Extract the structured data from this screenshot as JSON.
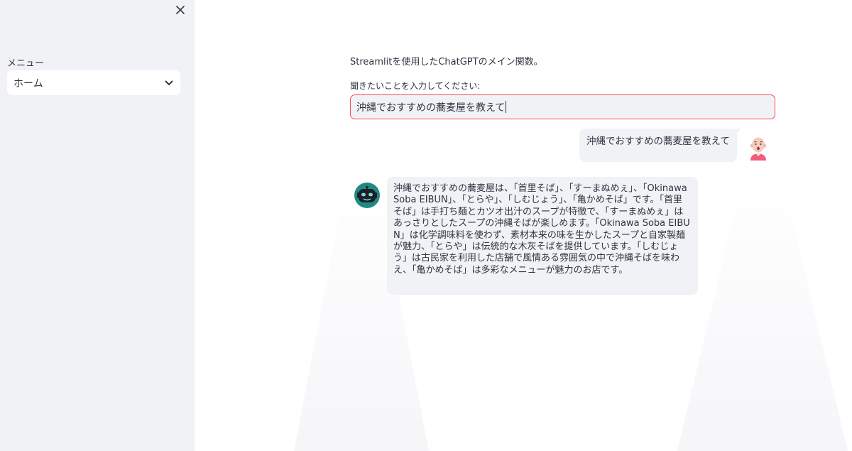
{
  "sidebar": {
    "close_icon": "close-icon",
    "menu_label": "メニュー",
    "select": {
      "value": "ホーム",
      "icon": "chevron-down-icon"
    }
  },
  "main": {
    "description": "Streamlitを使用したChatGPTのメイン関数。",
    "input": {
      "label": "聞きたいことを入力してください:",
      "value": "沖縄でおすすめの蕎麦屋を教えて"
    },
    "messages": [
      {
        "role": "user",
        "avatar": "user-avatar-icon",
        "text": "沖縄でおすすめの蕎麦屋を教えて"
      },
      {
        "role": "assistant",
        "avatar": "bot-avatar-icon",
        "text": "沖縄でおすすめの蕎麦屋は、「首里そば」、「すーまぬめぇ」、「Okinawa Soba EIBUN」、「とらや」、「しむじょう」、「亀かめそば」です。「首里そば」は手打ち麺とカツオ出汁のスープが特徴で、「すーまぬめぇ」はあっさりとしたスープの沖縄そばが楽しめます。「Okinawa Soba EIBUN」は化学調味料を使わず、素材本来の味を生かしたスープと自家製麺が魅力、「とらや」は伝統的な木灰そばを提供しています。「しむじょう」は古民家を利用した店舗で風情ある雰囲気の中で沖縄そばを味わえ、「亀かめそば」は多彩なメニューが魅力のお店です。"
      }
    ]
  },
  "colors": {
    "sidebar_bg": "#f0f2f6",
    "accent_border": "#ff4b4b",
    "text": "#31333f",
    "bot_avatar": "#1f8a82"
  }
}
